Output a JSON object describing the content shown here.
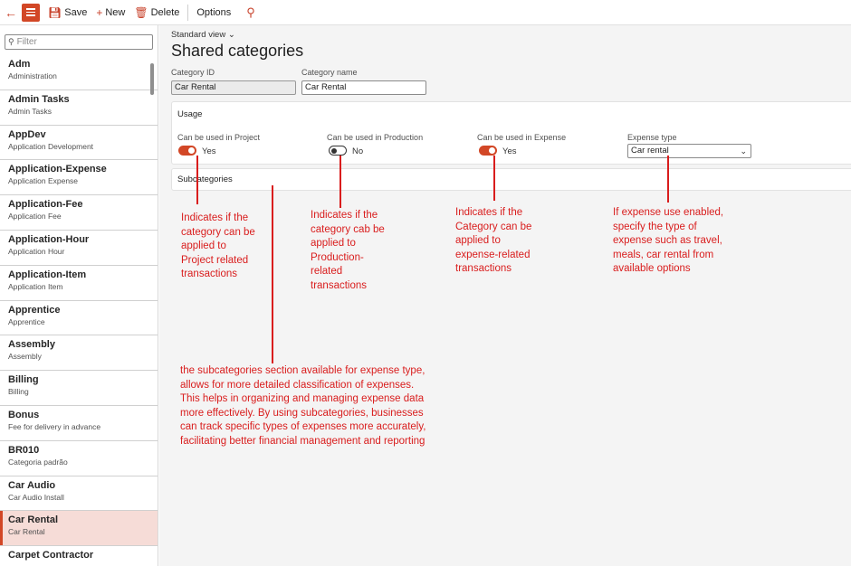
{
  "toolbar": {
    "save_label": "Save",
    "new_label": "New",
    "delete_label": "Delete",
    "options_label": "Options"
  },
  "sidebar": {
    "filter_placeholder": "Filter",
    "items": [
      {
        "title": "Adm",
        "subtitle": "Administration"
      },
      {
        "title": "Admin Tasks",
        "subtitle": "Admin Tasks"
      },
      {
        "title": "AppDev",
        "subtitle": "Application Development"
      },
      {
        "title": "Application-Expense",
        "subtitle": "Application Expense"
      },
      {
        "title": "Application-Fee",
        "subtitle": "Application Fee"
      },
      {
        "title": "Application-Hour",
        "subtitle": "Application Hour"
      },
      {
        "title": "Application-Item",
        "subtitle": "Application Item"
      },
      {
        "title": "Apprentice",
        "subtitle": "Apprentice"
      },
      {
        "title": "Assembly",
        "subtitle": "Assembly"
      },
      {
        "title": "Billing",
        "subtitle": "Billing"
      },
      {
        "title": "Bonus",
        "subtitle": "Fee for delivery in advance"
      },
      {
        "title": "BR010",
        "subtitle": "Categoria padrão"
      },
      {
        "title": "Car Audio",
        "subtitle": "Car Audio Install"
      },
      {
        "title": "Car Rental",
        "subtitle": "Car Rental"
      },
      {
        "title": "Carpet Contractor",
        "subtitle": ""
      }
    ]
  },
  "main": {
    "view_label": "Standard view",
    "title": "Shared categories",
    "category_id_label": "Category ID",
    "category_id_value": "Car Rental",
    "category_name_label": "Category name",
    "category_name_value": "Car Rental",
    "usage": {
      "header": "Usage",
      "project_label": "Can be used in Project",
      "project_value": "Yes",
      "production_label": "Can be used in Production",
      "production_value": "No",
      "expense_label": "Can be used in Expense",
      "expense_value": "Yes",
      "expense_type_label": "Expense type",
      "expense_type_value": "Car rental"
    },
    "subcategories_header": "Subcategories"
  },
  "annotations": {
    "project": "Indicates if the\ncategory can be\napplied to\nProject related\ntransactions",
    "production": "Indicates if the\ncategory cab be\napplied to\nProduction-\nrelated\ntransactions",
    "expense": "Indicates if the\nCategory can be\napplied to\nexpense-related\ntransactions",
    "expense_type": "If expense use enabled,\nspecify the type of\nexpense such as travel,\nmeals, car rental from\navailable options",
    "subcategories": "the subcategories section available for expense type,\nallows for more detailed classification of expenses.\nThis helps in organizing and managing expense data\nmore effectively. By using subcategories, businesses\ncan track specific types of expenses more accurately,\nfacilitating better financial management and reporting"
  },
  "colors": {
    "accent": "#d24726",
    "annotation": "#d91d1d",
    "selected_row": "#f6dcd7"
  }
}
